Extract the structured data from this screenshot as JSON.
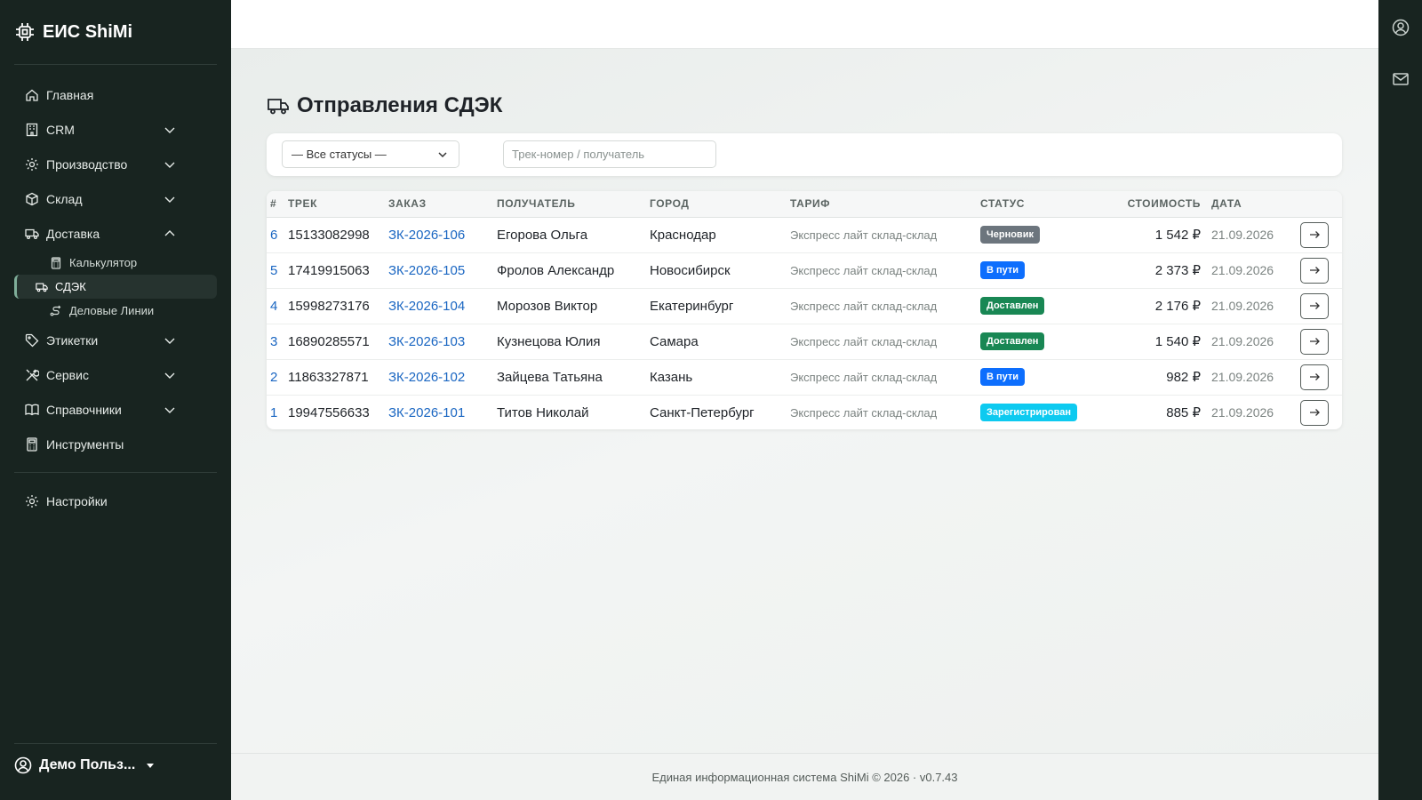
{
  "brand": {
    "name": "ЕИС ShiMi",
    "icon": "chip-icon"
  },
  "nav": {
    "items": [
      {
        "label": "Главная",
        "icon": "home-icon"
      },
      {
        "label": "CRM",
        "icon": "building-icon"
      },
      {
        "label": "Производство",
        "icon": "gear-icon"
      },
      {
        "label": "Склад",
        "icon": "box-icon"
      },
      {
        "label": "Доставка",
        "icon": "truck-icon"
      },
      {
        "label": "Этикетки",
        "icon": "tag-icon"
      },
      {
        "label": "Сервис",
        "icon": "tools-icon"
      },
      {
        "label": "Справочники",
        "icon": "book-icon"
      },
      {
        "label": "Инструменты",
        "icon": "calculator-icon"
      }
    ],
    "delivery_sub": [
      {
        "label": "Калькулятор",
        "icon": "calculator-icon"
      },
      {
        "label": "СДЭК",
        "icon": "truck-icon"
      },
      {
        "label": "Деловые Линии",
        "icon": "route-icon"
      }
    ],
    "settings": {
      "label": "Настройки",
      "icon": "gear-icon"
    }
  },
  "user": {
    "name": "Демо Польз...",
    "icon": "user-circle-icon"
  },
  "page": {
    "title": "Отправления СДЭК",
    "icon": "truck-icon"
  },
  "filters": {
    "status_value": "— Все статусы —",
    "search_placeholder": "Трек-номер / получатель"
  },
  "table": {
    "headers": [
      "#",
      "ТРЕК",
      "ЗАКАЗ",
      "ПОЛУЧАТЕЛЬ",
      "ГОРОД",
      "ТАРИФ",
      "СТАТУС",
      "СТОИМОСТЬ",
      "ДАТА",
      ""
    ],
    "rows": [
      {
        "num": "6",
        "track": "15133082998",
        "order": "ЗК-2026-106",
        "recipient": "Егорова Ольга",
        "city": "Краснодар",
        "tariff": "Экспресс лайт склад-склад",
        "status": "Черновик",
        "status_color": "#6c757d",
        "cost": "1 542 ₽",
        "date": "21.09.2026"
      },
      {
        "num": "5",
        "track": "17419915063",
        "order": "ЗК-2026-105",
        "recipient": "Фролов Александр",
        "city": "Новосибирск",
        "tariff": "Экспресс лайт склад-склад",
        "status": "В пути",
        "status_color": "#0d6efd",
        "cost": "2 373 ₽",
        "date": "21.09.2026"
      },
      {
        "num": "4",
        "track": "15998273176",
        "order": "ЗК-2026-104",
        "recipient": "Морозов Виктор",
        "city": "Екатеринбург",
        "tariff": "Экспресс лайт склад-склад",
        "status": "Доставлен",
        "status_color": "#198754",
        "cost": "2 176 ₽",
        "date": "21.09.2026"
      },
      {
        "num": "3",
        "track": "16890285571",
        "order": "ЗК-2026-103",
        "recipient": "Кузнецова Юлия",
        "city": "Самара",
        "tariff": "Экспресс лайт склад-склад",
        "status": "Доставлен",
        "status_color": "#198754",
        "cost": "1 540 ₽",
        "date": "21.09.2026"
      },
      {
        "num": "2",
        "track": "11863327871",
        "order": "ЗК-2026-102",
        "recipient": "Зайцева Татьяна",
        "city": "Казань",
        "tariff": "Экспресс лайт склад-склад",
        "status": "В пути",
        "status_color": "#0d6efd",
        "cost": "982 ₽",
        "date": "21.09.2026"
      },
      {
        "num": "1",
        "track": "19947556633",
        "order": "ЗК-2026-101",
        "recipient": "Титов Николай",
        "city": "Санкт-Петербург",
        "tariff": "Экспресс лайт склад-склад",
        "status": "Зарегистрирован",
        "status_color": "#0dcaf0",
        "cost": "885 ₽",
        "date": "21.09.2026"
      }
    ]
  },
  "footer": {
    "text": "Единая информационная система ShiMi © 2026 · v0.7.43"
  }
}
